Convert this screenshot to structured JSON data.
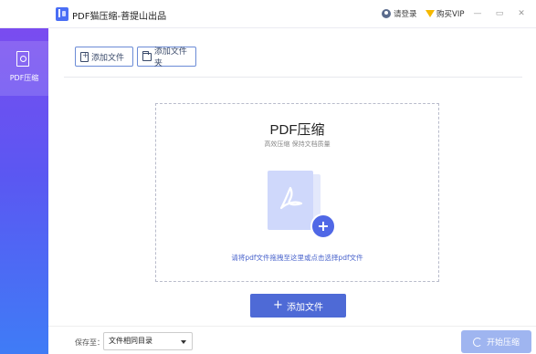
{
  "titlebar": {
    "app_title": "PDF猫压缩-菩提山出品",
    "login_label": "请登录",
    "vip_label": "购买VIP",
    "minimize_glyph": "—",
    "maximize_glyph": "▭",
    "close_glyph": "✕"
  },
  "sidebar": {
    "items": [
      {
        "label": "PDF压缩"
      }
    ]
  },
  "toolbar": {
    "add_file_label": "添加文件",
    "add_folder_label": "添加文件夹"
  },
  "dropzone": {
    "title": "PDF压缩",
    "subtitle": "高效压缩 保持文档质量",
    "hint": "请将pdf文件拖拽至这里或点击选择pdf文件"
  },
  "main": {
    "add_file_button": "添加文件"
  },
  "bottom": {
    "save_to_label": "保存至：",
    "save_location_value": "文件相同目录",
    "start_button": "开始压缩"
  },
  "colors": {
    "accent": "#4e6ad6",
    "sidebar_top": "#7a4cf0",
    "sidebar_bottom": "#3f7cf6",
    "start_disabled": "#9fb5f0",
    "vip_gold": "#f5b800"
  },
  "icons": [
    "app-logo-icon",
    "user-icon",
    "vip-diamond-icon",
    "pdf-icon",
    "file-add-icon",
    "folder-add-icon",
    "acrobat-icon",
    "plus-circle-icon",
    "dropdown-caret-icon",
    "refresh-icon"
  ]
}
